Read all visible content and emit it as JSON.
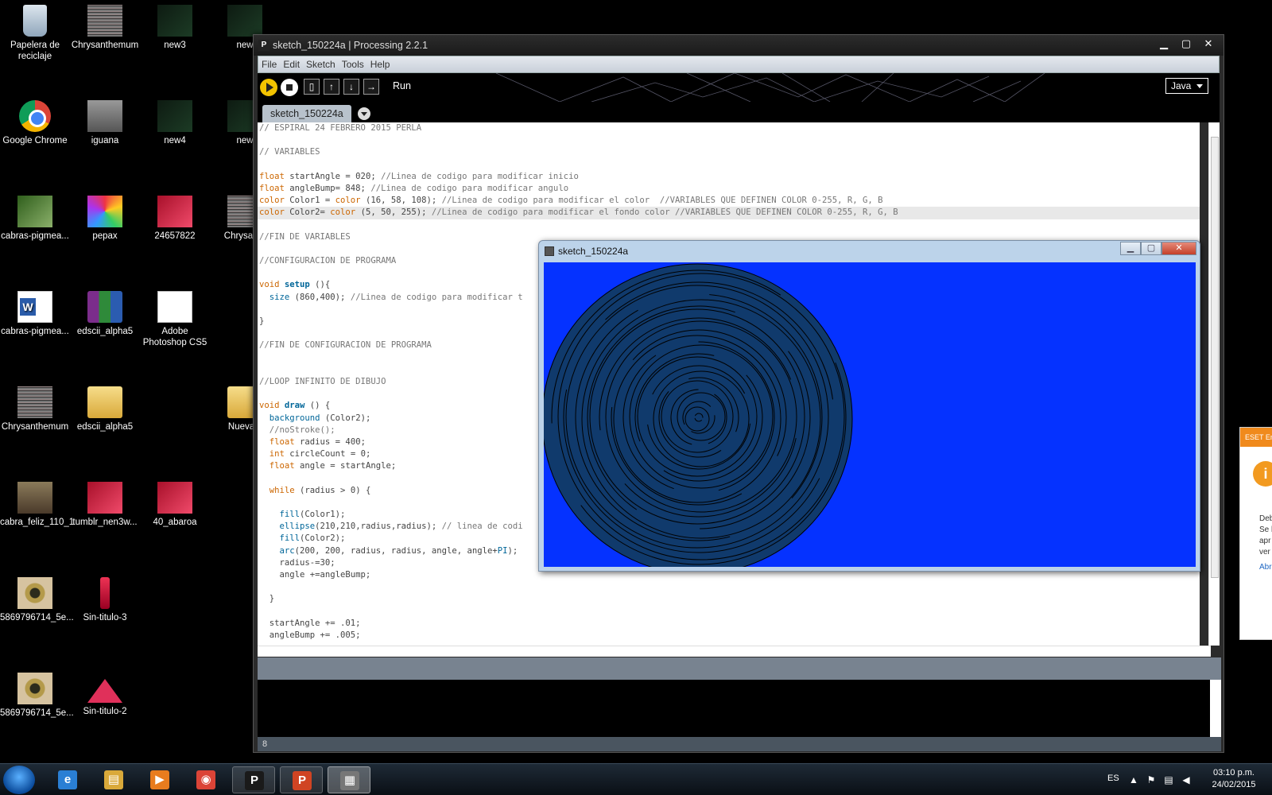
{
  "desktop": {
    "icons": [
      {
        "label": "Papelera de reciclaje",
        "kind": "bin"
      },
      {
        "label": "Chrysanthemum",
        "kind": "noise"
      },
      {
        "label": "new3",
        "kind": "dark"
      },
      {
        "label": "new",
        "kind": "dark"
      },
      {
        "label": "Google Chrome",
        "kind": "chrome"
      },
      {
        "label": "iguana",
        "kind": "gray"
      },
      {
        "label": "new4",
        "kind": "dark"
      },
      {
        "label": "new",
        "kind": "dark"
      },
      {
        "label": "cabras-pigmea...",
        "kind": "green"
      },
      {
        "label": "pepax",
        "kind": "colorful"
      },
      {
        "label": "24657822",
        "kind": "red"
      },
      {
        "label": "Chrysanth",
        "kind": "noise"
      },
      {
        "label": "cabras-pigmea...",
        "kind": "word"
      },
      {
        "label": "edscii_alpha5",
        "kind": "rar"
      },
      {
        "label": "Adobe Photoshop CS5",
        "kind": "ps"
      },
      {
        "label": "Chrysanthemum",
        "kind": "noise"
      },
      {
        "label": "edscii_alpha5",
        "kind": "folder"
      },
      {
        "label": "Nueva c",
        "kind": "folder"
      },
      {
        "label": "cabra_feliz_110_1",
        "kind": "goat"
      },
      {
        "label": "tumblr_nen3w...",
        "kind": "red"
      },
      {
        "label": "40_abaroa",
        "kind": "red"
      },
      {
        "label": "5869796714_5e...",
        "kind": "eye"
      },
      {
        "label": "Sin-titulo-3",
        "kind": "tall"
      },
      {
        "label": "5869796714_5e...",
        "kind": "eye"
      },
      {
        "label": "Sin-titulo-2",
        "kind": "pyr"
      }
    ]
  },
  "processing": {
    "title": "sketch_150224a | Processing 2.2.1",
    "app_icon": "P",
    "menu": [
      "File",
      "Edit",
      "Sketch",
      "Tools",
      "Help"
    ],
    "toolbar": {
      "run_label": "Run",
      "buttons": [
        "run-icon",
        "stop-icon",
        "new-icon",
        "open-icon",
        "save-icon",
        "export-icon"
      ],
      "mode": "Java"
    },
    "tab": "sketch_150224a",
    "status_line": "8",
    "colors": {
      "keyword": "#cc6600",
      "function": "#006699",
      "comment": "#777777",
      "background": "#2b2b2b"
    }
  },
  "code_lines": [
    [
      {
        "t": "// ESPIRAL 24 FEBRERO 2015 PERLA",
        "c": "cm"
      }
    ],
    [],
    [
      {
        "t": "// VARIABLES",
        "c": "cm"
      }
    ],
    [],
    [
      {
        "t": "float",
        "c": "kw"
      },
      {
        "t": " startAngle = 020; ",
        "c": ""
      },
      {
        "t": "//Linea de codigo para modificar inicio",
        "c": "cm"
      }
    ],
    [
      {
        "t": "float",
        "c": "kw"
      },
      {
        "t": " angleBump= 848; ",
        "c": ""
      },
      {
        "t": "//Linea de codigo para modificar angulo",
        "c": "cm"
      }
    ],
    [
      {
        "t": "color",
        "c": "kw"
      },
      {
        "t": " Color1 = ",
        "c": ""
      },
      {
        "t": "color",
        "c": "kw"
      },
      {
        "t": " (16, 58, 108); ",
        "c": ""
      },
      {
        "t": "//Linea de codigo para modificar el color  //VARIABLES QUE DEFINEN COLOR 0-255, R, G, B",
        "c": "cm"
      }
    ],
    [
      {
        "t": "color",
        "c": "kw"
      },
      {
        "t": " Color2= ",
        "c": ""
      },
      {
        "t": "color",
        "c": "kw"
      },
      {
        "t": " (5, 50, 255); ",
        "c": ""
      },
      {
        "t": "//Linea de codigo para modificar el fondo color //VARIABLES QUE DEFINEN COLOR 0-255, R, G, B",
        "c": "cm"
      }
    ],
    [],
    [
      {
        "t": "//FIN DE VARIABLES",
        "c": "cm"
      }
    ],
    [],
    [
      {
        "t": "//CONFIGURACION DE PROGRAMA",
        "c": "cm"
      }
    ],
    [],
    [
      {
        "t": "void",
        "c": "kw"
      },
      {
        "t": " ",
        "c": ""
      },
      {
        "t": "setup",
        "c": "fn"
      },
      {
        "t": " (){",
        "c": ""
      }
    ],
    [
      {
        "t": "  ",
        "c": ""
      },
      {
        "t": "size",
        "c": "fn2"
      },
      {
        "t": " (860,400); ",
        "c": ""
      },
      {
        "t": "//Linea de codigo para modificar t",
        "c": "cm"
      }
    ],
    [],
    [
      {
        "t": "}",
        "c": ""
      }
    ],
    [],
    [
      {
        "t": "//FIN DE CONFIGURACION DE PROGRAMA",
        "c": "cm"
      }
    ],
    [],
    [],
    [
      {
        "t": "//LOOP INFINITO DE DIBUJO",
        "c": "cm"
      }
    ],
    [],
    [
      {
        "t": "void",
        "c": "kw"
      },
      {
        "t": " ",
        "c": ""
      },
      {
        "t": "draw",
        "c": "fn"
      },
      {
        "t": " () {",
        "c": ""
      }
    ],
    [
      {
        "t": "  ",
        "c": ""
      },
      {
        "t": "background",
        "c": "fn2"
      },
      {
        "t": " (Color2);",
        "c": ""
      }
    ],
    [
      {
        "t": "  //noStroke();",
        "c": "cm"
      }
    ],
    [
      {
        "t": "  ",
        "c": ""
      },
      {
        "t": "float",
        "c": "kw"
      },
      {
        "t": " radius = 400;",
        "c": ""
      }
    ],
    [
      {
        "t": "  ",
        "c": ""
      },
      {
        "t": "int",
        "c": "kw"
      },
      {
        "t": " circleCount = 0;",
        "c": ""
      }
    ],
    [
      {
        "t": "  ",
        "c": ""
      },
      {
        "t": "float",
        "c": "kw"
      },
      {
        "t": " angle = startAngle;",
        "c": ""
      }
    ],
    [],
    [
      {
        "t": "  ",
        "c": ""
      },
      {
        "t": "while",
        "c": "kw"
      },
      {
        "t": " (radius > 0) {",
        "c": ""
      }
    ],
    [],
    [
      {
        "t": "    ",
        "c": ""
      },
      {
        "t": "fill",
        "c": "fn2"
      },
      {
        "t": "(Color1);",
        "c": ""
      }
    ],
    [
      {
        "t": "    ",
        "c": ""
      },
      {
        "t": "ellipse",
        "c": "fn2"
      },
      {
        "t": "(210,210,radius,radius); ",
        "c": ""
      },
      {
        "t": "// linea de codi",
        "c": "cm"
      }
    ],
    [
      {
        "t": "    ",
        "c": ""
      },
      {
        "t": "fill",
        "c": "fn2"
      },
      {
        "t": "(Color2);",
        "c": ""
      }
    ],
    [
      {
        "t": "    ",
        "c": ""
      },
      {
        "t": "arc",
        "c": "fn2"
      },
      {
        "t": "(200, 200, radius, radius, angle, angle+",
        "c": ""
      },
      {
        "t": "PI",
        "c": "fn2"
      },
      {
        "t": ");",
        "c": ""
      }
    ],
    [
      {
        "t": "    radius-=30;",
        "c": ""
      }
    ],
    [
      {
        "t": "    angle +=angleBump;",
        "c": ""
      }
    ],
    [],
    [
      {
        "t": "  }",
        "c": ""
      }
    ],
    [],
    [
      {
        "t": "  startAngle += .01;",
        "c": ""
      }
    ],
    [
      {
        "t": "  angleBump += .005;",
        "c": ""
      }
    ]
  ],
  "sketch_window": {
    "title": "sketch_150224a",
    "fill_color": "#103a6c",
    "background_color": "#0532ff"
  },
  "eset": {
    "header": "ESET En",
    "lines": [
      "Deb",
      "Se l",
      "apr",
      "ver"
    ],
    "link": "Abr"
  },
  "taskbar": {
    "apps": [
      {
        "name": "internet-explorer-icon",
        "glyph": "e",
        "color": "#2a7fd4",
        "state": "pinned"
      },
      {
        "name": "file-explorer-icon",
        "glyph": "▤",
        "color": "#d9a93a",
        "state": "pinned"
      },
      {
        "name": "media-player-icon",
        "glyph": "▶",
        "color": "#e87c1e",
        "state": "pinned"
      },
      {
        "name": "chrome-icon",
        "glyph": "◉",
        "color": "#db4437",
        "state": "pinned"
      },
      {
        "name": "processing-icon",
        "glyph": "P",
        "color": "#1a1a1a",
        "state": "open"
      },
      {
        "name": "powerpoint-icon",
        "glyph": "P",
        "color": "#d04423",
        "state": "open"
      },
      {
        "name": "sketch-window-icon",
        "glyph": "▦",
        "color": "#777777",
        "state": "active"
      }
    ],
    "language": "ES",
    "time": "03:10 p.m.",
    "date": "24/02/2015"
  }
}
